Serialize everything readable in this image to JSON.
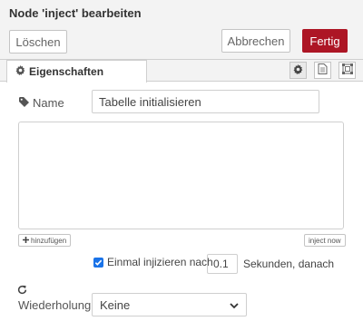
{
  "header": {
    "title": "Node 'inject' bearbeiten",
    "delete_label": "Löschen",
    "cancel_label": "Abbrechen",
    "done_label": "Fertig"
  },
  "tabs": {
    "properties_label": "Eigenschaften"
  },
  "form": {
    "name_label": "Name",
    "name_value": "Tabelle initialisieren",
    "add_label": "hinzufügen",
    "inject_now_label": "inject now",
    "once_label": "Einmal injizieren nach",
    "once_checked": true,
    "delay_value": "0.1",
    "seconds_label": "Sekunden, danach",
    "repeat_label": "Wiederholung",
    "repeat_value": "Keine"
  },
  "colors": {
    "primary": "#ad1625",
    "checkbox": "#1a73e8"
  }
}
